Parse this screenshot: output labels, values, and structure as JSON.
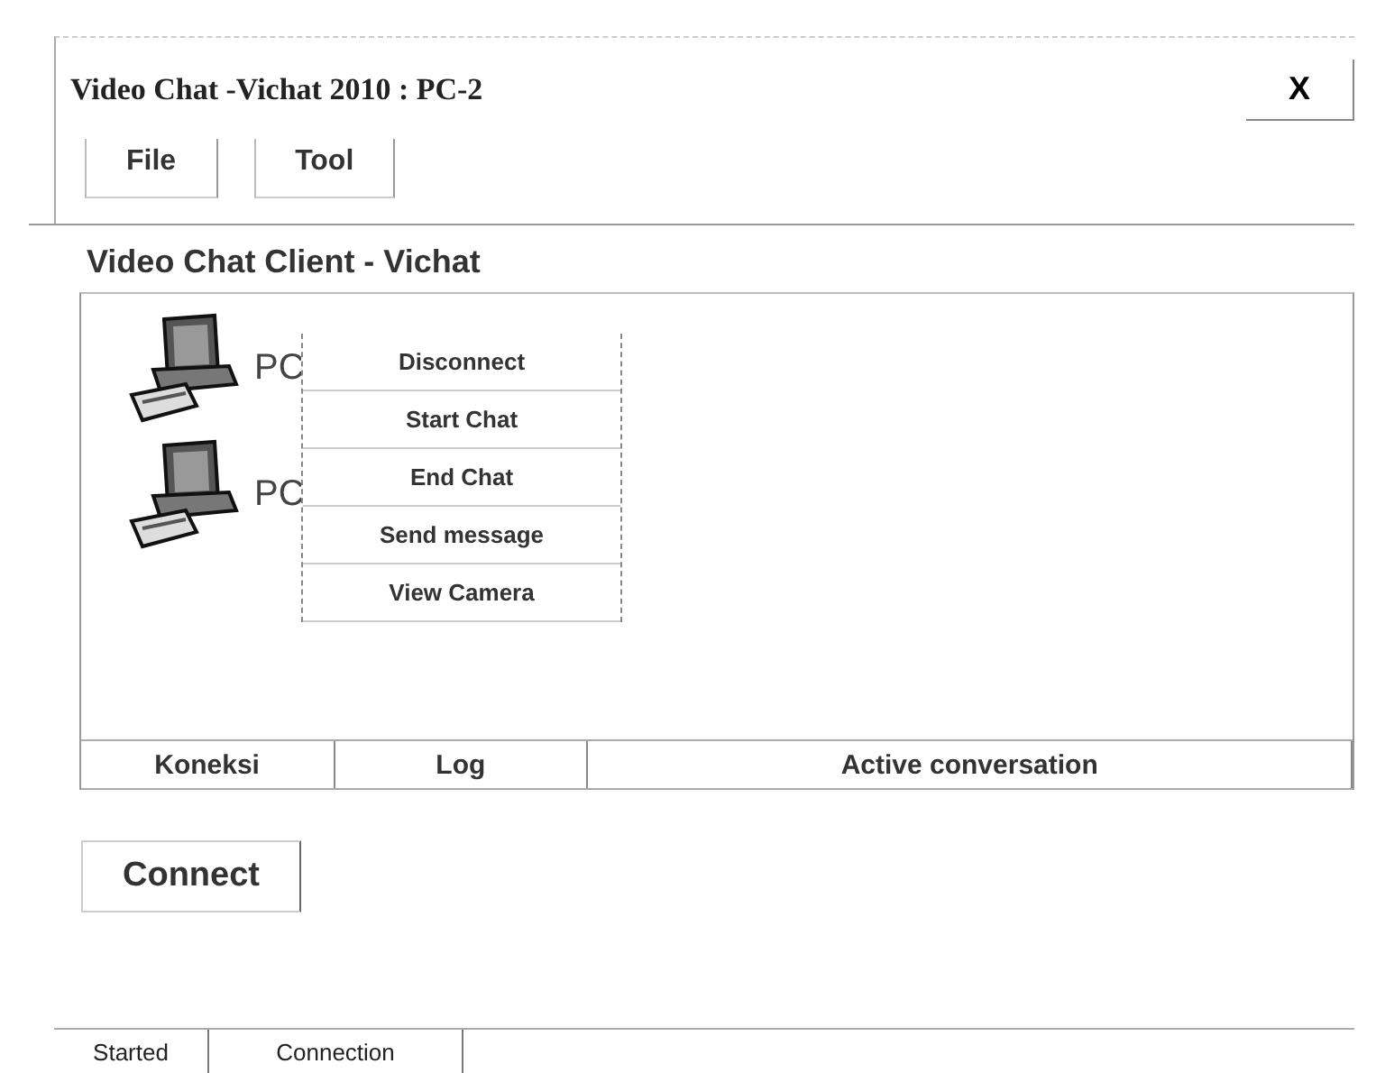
{
  "window": {
    "title": "Video Chat -Vichat 2010 : PC-2",
    "close": "X"
  },
  "menu": [
    "File",
    "Tool"
  ],
  "heading": "Video Chat Client - Vichat",
  "nodes": [
    {
      "label": "PC"
    },
    {
      "label": "PC"
    }
  ],
  "context_menu": [
    "Disconnect",
    "Start Chat",
    "End Chat",
    "Send message",
    "View Camera"
  ],
  "tabs": [
    "Koneksi",
    "Log",
    "Active conversation"
  ],
  "connect_button": "Connect",
  "status_bar": [
    "Started",
    "Connection"
  ]
}
